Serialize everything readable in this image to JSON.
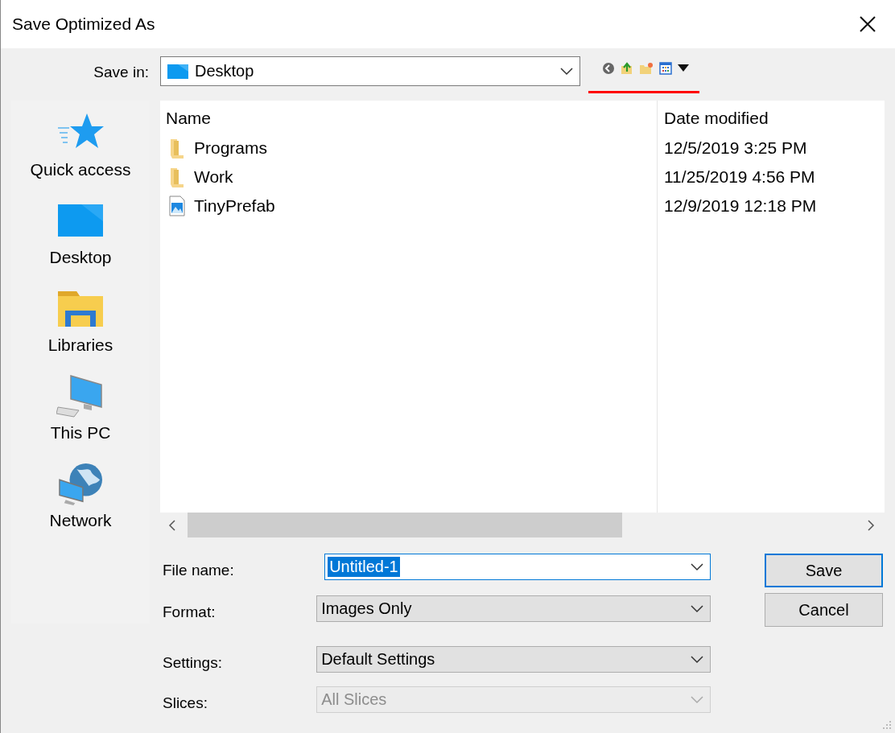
{
  "window": {
    "title": "Save Optimized As"
  },
  "save_in": {
    "label": "Save in:",
    "value": "Desktop"
  },
  "sidebar": {
    "items": [
      {
        "label": "Quick access",
        "kind": "star",
        "selected": false
      },
      {
        "label": "Desktop",
        "kind": "desktop",
        "selected": false
      },
      {
        "label": "Libraries",
        "kind": "libraries",
        "selected": false
      },
      {
        "label": "This PC",
        "kind": "pc",
        "selected": false
      },
      {
        "label": "Network",
        "kind": "network",
        "selected": false
      }
    ]
  },
  "file_list": {
    "columns": [
      "Name",
      "Date modified"
    ],
    "rows": [
      {
        "name": "Programs",
        "kind": "folder",
        "date": "12/5/2019 3:25 PM",
        "selected": false
      },
      {
        "name": "Work",
        "kind": "folder",
        "date": "11/25/2019 4:56 PM",
        "selected": false
      },
      {
        "name": "TinyPrefab",
        "kind": "image",
        "date": "12/9/2019 12:18 PM",
        "selected": false
      }
    ]
  },
  "fields": [
    {
      "label": "File name:",
      "value": "Untitled-1",
      "kind": "combo",
      "highlighted": true,
      "disabled": false
    },
    {
      "label": "Format:",
      "value": "Images Only",
      "kind": "dropdown",
      "highlighted": false,
      "disabled": false
    },
    {
      "label": "Settings:",
      "value": "Default Settings",
      "kind": "dropdown",
      "highlighted": false,
      "disabled": false
    },
    {
      "label": "Slices:",
      "value": "All Slices",
      "kind": "dropdown",
      "highlighted": false,
      "disabled": true
    }
  ],
  "buttons": [
    {
      "label": "Save",
      "default": true
    },
    {
      "label": "Cancel",
      "default": false
    }
  ]
}
